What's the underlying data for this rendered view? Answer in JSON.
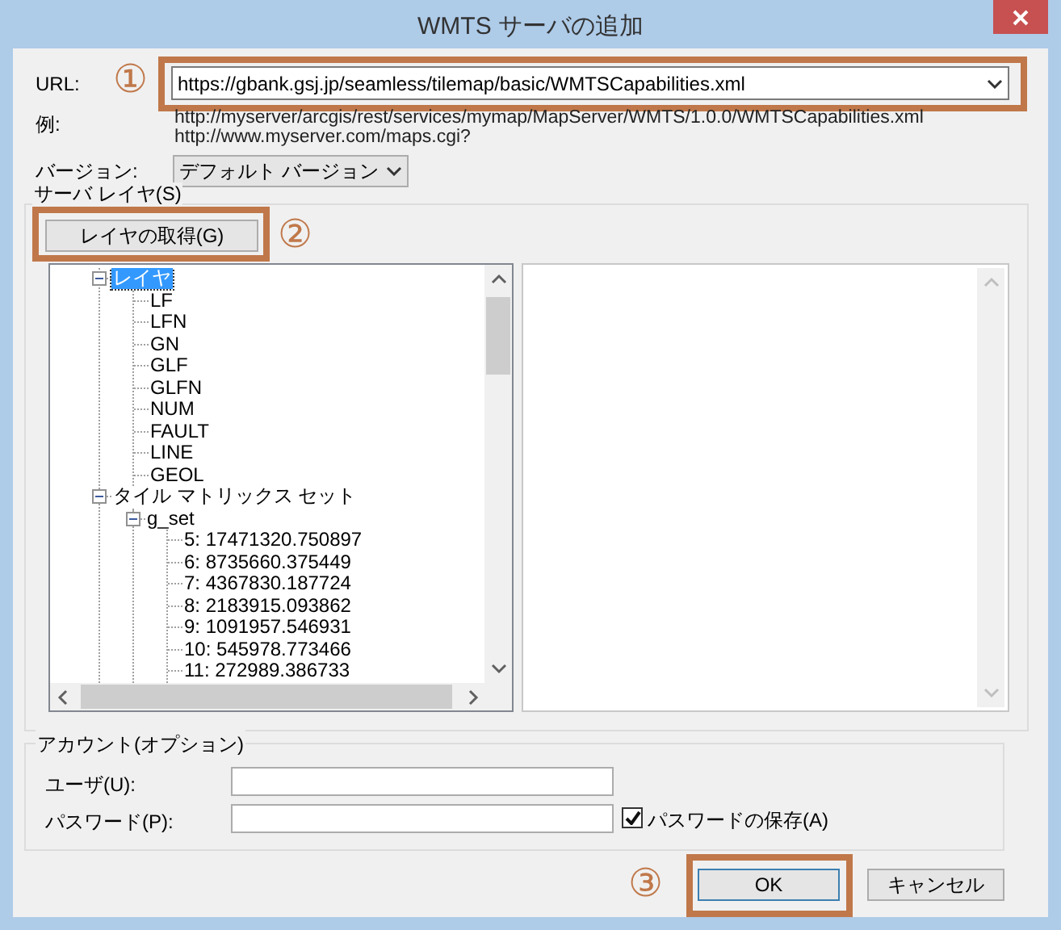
{
  "window": {
    "title": "WMTS サーバの追加"
  },
  "url": {
    "label": "URL:",
    "value": "https://gbank.gsj.jp/seamless/tilemap/basic/WMTSCapabilities.xml",
    "callout": "①"
  },
  "example": {
    "label": "例:",
    "lines": [
      "http://myserver/arcgis/rest/services/mymap/MapServer/WMTS/1.0.0/WMTSCapabilities.xml",
      "http://www.myserver.com/maps.cgi?"
    ]
  },
  "version": {
    "label": "バージョン:",
    "value": "デフォルト バージョン"
  },
  "server_layers": {
    "label": "サーバ レイヤ(S)",
    "get_button": {
      "label": "レイヤの取得(G)",
      "callout": "②"
    },
    "tree": [
      {
        "label": "レイヤ",
        "expanded": true,
        "selected": true,
        "children": [
          {
            "label": "LF",
            "selected": false
          },
          {
            "label": "LFN",
            "selected": false
          },
          {
            "label": "GN",
            "selected": false
          },
          {
            "label": "GLF",
            "selected": false
          },
          {
            "label": "GLFN",
            "selected": false
          },
          {
            "label": "NUM",
            "selected": false
          },
          {
            "label": "FAULT",
            "selected": false
          },
          {
            "label": "LINE",
            "selected": false
          },
          {
            "label": "GEOL",
            "selected": false
          }
        ]
      },
      {
        "label": "タイル マトリックス セット",
        "expanded": true,
        "selected": false,
        "children": [
          {
            "label": "g_set",
            "expanded": true,
            "selected": false,
            "children": [
              {
                "label": "5: 17471320.750897",
                "selected": false
              },
              {
                "label": "6: 8735660.375449",
                "selected": false
              },
              {
                "label": "7: 4367830.187724",
                "selected": false
              },
              {
                "label": "8: 2183915.093862",
                "selected": false
              },
              {
                "label": "9: 1091957.546931",
                "selected": false
              },
              {
                "label": "10: 545978.773466",
                "selected": false
              },
              {
                "label": "11: 272989.386733",
                "selected": false
              }
            ]
          }
        ]
      }
    ]
  },
  "account": {
    "label": "アカウント(オプション)",
    "user_label": "ユーザ(U):",
    "password_label": "パスワード(P):",
    "save_password": {
      "label": "パスワードの保存(A)",
      "checked": true
    }
  },
  "buttons": [
    {
      "label": "OK",
      "default": true
    },
    {
      "label": "キャンセル",
      "default": false
    }
  ],
  "ok_callout": "③"
}
